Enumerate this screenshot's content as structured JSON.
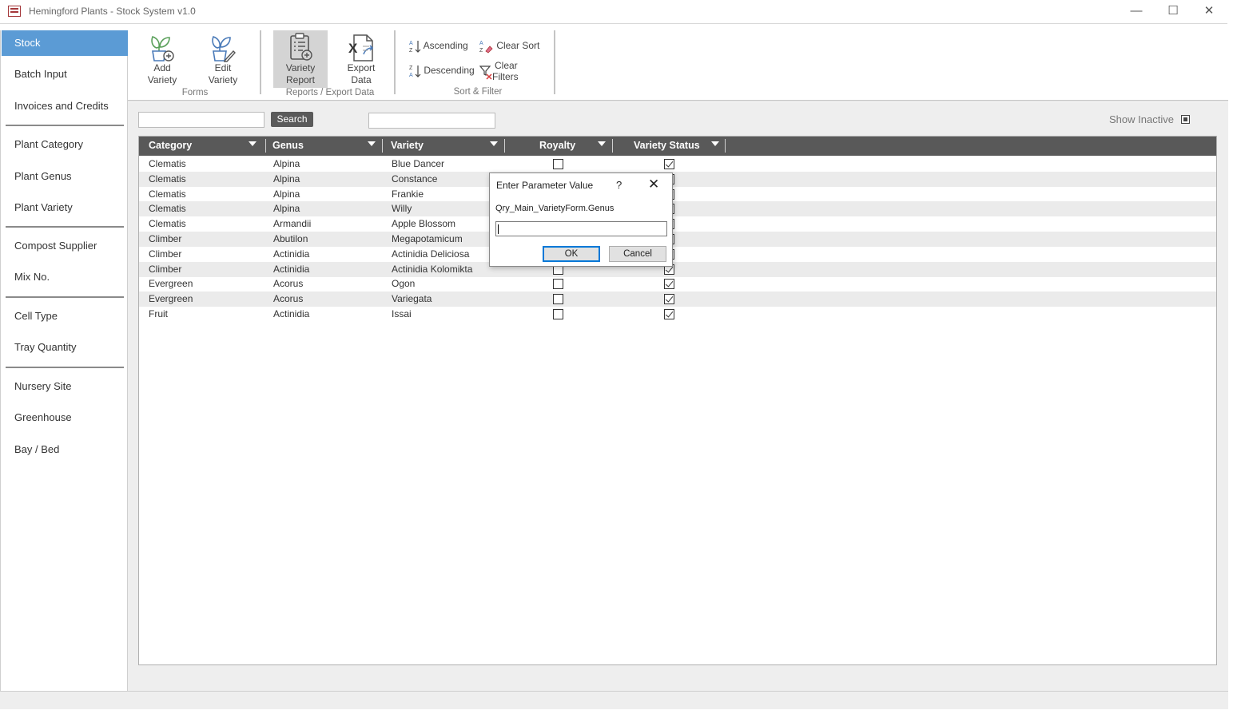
{
  "window": {
    "title": "Hemingford Plants - Stock System v1.0",
    "minimize_glyph": "—",
    "maximize_glyph": "☐",
    "close_glyph": "✕"
  },
  "sidebar": {
    "items": [
      {
        "label": "Stock",
        "active": true
      },
      {
        "label": "Batch Input"
      },
      {
        "label": "Invoices and Credits"
      },
      {
        "label": "Plant Category"
      },
      {
        "label": "Plant Genus"
      },
      {
        "label": "Plant Variety"
      },
      {
        "label": "Compost Supplier"
      },
      {
        "label": "Mix No."
      },
      {
        "label": "Cell Type"
      },
      {
        "label": "Tray Quantity"
      },
      {
        "label": "Nursery Site"
      },
      {
        "label": "Greenhouse"
      },
      {
        "label": "Bay / Bed"
      }
    ]
  },
  "ribbon": {
    "forms": {
      "add_line1": "Add",
      "add_line2": "Variety",
      "edit_line1": "Edit",
      "edit_line2": "Variety",
      "group": "Forms"
    },
    "reports": {
      "report_line1": "Variety",
      "report_line2": "Report",
      "export_line1": "Export",
      "export_line2": "Data",
      "group": "Reports / Export Data"
    },
    "sort_filter": {
      "ascending": "Ascending",
      "descending": "Descending",
      "clear_sort": "Clear Sort",
      "clear_filters_line1": "Clear",
      "clear_filters_line2": "Filters",
      "group": "Sort & Filter"
    }
  },
  "toolbar": {
    "search_label": "Search",
    "search_value": "",
    "filter_value": "",
    "show_inactive_label": "Show Inactive"
  },
  "table": {
    "headers": [
      "Category",
      "Genus",
      "Variety",
      "Royalty",
      "Variety Status"
    ],
    "rows": [
      {
        "category": "Clematis",
        "genus": "Alpina",
        "variety": "Blue Dancer",
        "royalty": false,
        "status": true
      },
      {
        "category": "Clematis",
        "genus": "Alpina",
        "variety": "Constance",
        "royalty": false,
        "status": true
      },
      {
        "category": "Clematis",
        "genus": "Alpina",
        "variety": "Frankie",
        "royalty": false,
        "status": true
      },
      {
        "category": "Clematis",
        "genus": "Alpina",
        "variety": "Willy",
        "royalty": false,
        "status": true
      },
      {
        "category": "Clematis",
        "genus": "Armandii",
        "variety": "Apple Blossom",
        "royalty": false,
        "status": true
      },
      {
        "category": "Climber",
        "genus": "Abutilon",
        "variety": "Megapotamicum",
        "royalty": false,
        "status": true
      },
      {
        "category": "Climber",
        "genus": "Actinidia",
        "variety": "Actinidia Deliciosa",
        "royalty": false,
        "status": true
      },
      {
        "category": "Climber",
        "genus": "Actinidia",
        "variety": "Actinidia Kolomikta",
        "royalty": false,
        "status": true
      },
      {
        "category": "Evergreen",
        "genus": "Acorus",
        "variety": "Ogon",
        "royalty": false,
        "status": true
      },
      {
        "category": "Evergreen",
        "genus": "Acorus",
        "variety": "Variegata",
        "royalty": false,
        "status": true
      },
      {
        "category": "Fruit",
        "genus": "Actinidia",
        "variety": "Issai",
        "royalty": false,
        "status": true
      }
    ]
  },
  "dialog": {
    "title": "Enter Parameter Value",
    "help_glyph": "?",
    "close_glyph": "✕",
    "prompt": "Qry_Main_VarietyForm.Genus",
    "value": "",
    "ok_label": "OK",
    "cancel_label": "Cancel"
  }
}
